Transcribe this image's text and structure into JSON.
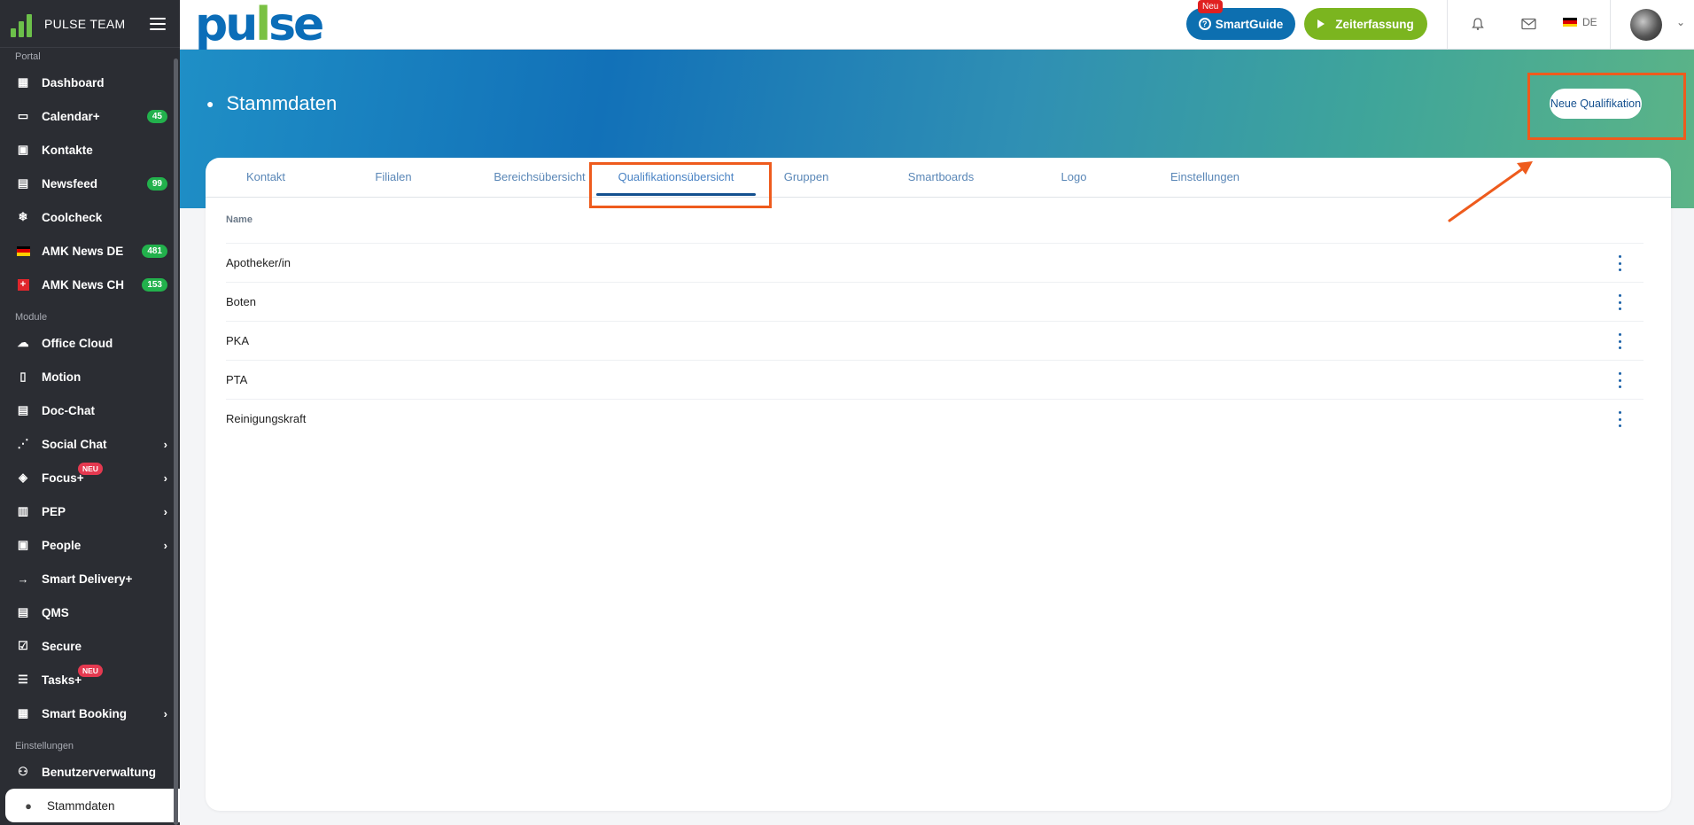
{
  "sidebar": {
    "team": "PULSE TEAM",
    "sections": {
      "portal": "Portal",
      "module": "Module",
      "einstellungen": "Einstellungen"
    },
    "portal_items": [
      {
        "label": "Dashboard",
        "icon": "dashboard-icon"
      },
      {
        "label": "Calendar+",
        "icon": "calendar-icon",
        "badge": "45"
      },
      {
        "label": "Kontakte",
        "icon": "contacts-icon"
      },
      {
        "label": "Newsfeed",
        "icon": "newsfeed-icon",
        "badge": "99"
      },
      {
        "label": "Coolcheck",
        "icon": "snowflake-icon"
      },
      {
        "label": "AMK News DE",
        "icon": "german-flag-icon",
        "badge": "481"
      },
      {
        "label": "AMK News CH",
        "icon": "swiss-flag-icon",
        "badge": "153"
      }
    ],
    "module_items": [
      {
        "label": "Office Cloud",
        "icon": "cloud-icon"
      },
      {
        "label": "Motion",
        "icon": "phone-icon"
      },
      {
        "label": "Doc-Chat",
        "icon": "chat-icon"
      },
      {
        "label": "Social Chat",
        "icon": "share-icon"
      },
      {
        "label": "Focus+",
        "icon": "graduation-cap-icon",
        "tag": "NEU"
      },
      {
        "label": "PEP",
        "icon": "clipboard-icon"
      },
      {
        "label": "People",
        "icon": "people-icon"
      },
      {
        "label": "Smart Delivery+",
        "icon": "arrow-right-icon"
      },
      {
        "label": "QMS",
        "icon": "document-icon"
      },
      {
        "label": "Secure",
        "icon": "checkbox-icon"
      },
      {
        "label": "Tasks+",
        "icon": "list-icon",
        "tag": "NEU"
      },
      {
        "label": "Smart Booking",
        "icon": "booking-icon"
      }
    ],
    "settings_items": [
      {
        "label": "Benutzerverwaltung",
        "icon": "users-icon"
      },
      {
        "label": "Stammdaten",
        "icon": "person-icon"
      }
    ]
  },
  "topbar": {
    "brand": "pulse",
    "smartguide_label": "SmartGuide",
    "smartguide_tag": "Neu",
    "zeiterfassung_label": "Zeiterfassung",
    "lang": "DE"
  },
  "hero": {
    "title": "Stammdaten",
    "button_label": "Neue Qualifikation"
  },
  "tabs": [
    "Kontakt",
    "Filialen",
    "Bereichsübersicht",
    "Qualifikationsübersicht",
    "Gruppen",
    "Smartboards",
    "Logo",
    "Einstellungen"
  ],
  "table": {
    "column": "Name",
    "rows": [
      "Apotheker/in",
      "Boten",
      "PKA",
      "PTA",
      "Reinigungskraft"
    ]
  },
  "colors": {
    "accent": "#13508f",
    "highlight": "#ee5b1d",
    "badge": "#22b14c"
  }
}
